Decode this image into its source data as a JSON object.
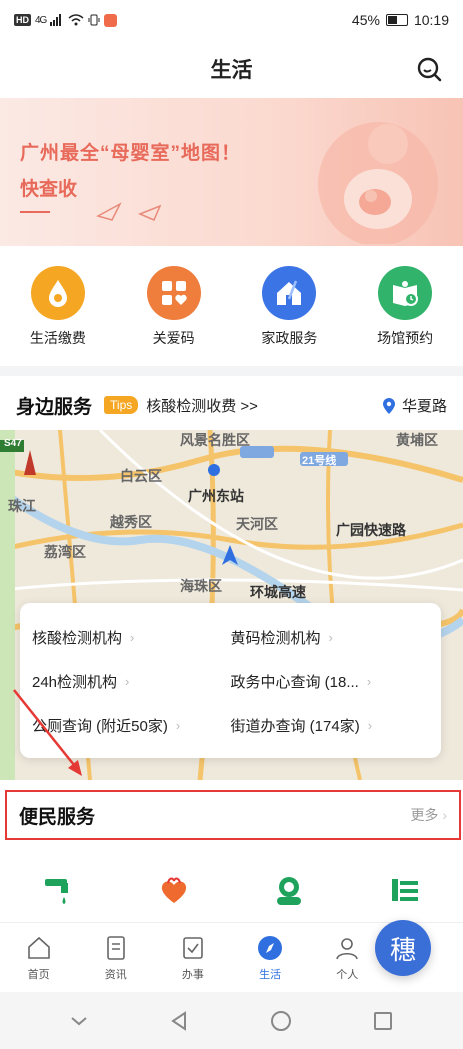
{
  "status_bar": {
    "battery": "45%",
    "time": "10:19",
    "net": "4G"
  },
  "header": {
    "title": "生活"
  },
  "banner": {
    "line1": "广州最全“母婴室”地图！",
    "line2": "快查收"
  },
  "quick_services": [
    {
      "label": "生活缴费",
      "icon": "water-drop-icon",
      "color": "#f5a623"
    },
    {
      "label": "关爱码",
      "icon": "care-code-icon",
      "color": "#ef7d3c"
    },
    {
      "label": "家政服务",
      "icon": "house-cleaning-icon",
      "color": "#3b74e5"
    },
    {
      "label": "场馆预约",
      "icon": "venue-booking-icon",
      "color": "#31b36b"
    }
  ],
  "nearby": {
    "title": "身边服务",
    "tips_badge": "Tips",
    "tips_text": "核酸检测收费 >>",
    "location": "华夏路"
  },
  "map_labels": [
    "风景名胜区",
    "黄埔区",
    "S47",
    "21号线",
    "白云区",
    "广州东站",
    "珠江",
    "越秀区",
    "天河区",
    "广园快速路",
    "荔湾区",
    "海珠区",
    "环城高速"
  ],
  "service_items": [
    {
      "label": "核酸检测机构"
    },
    {
      "label": "黄码检测机构"
    },
    {
      "label": "24h检测机构"
    },
    {
      "label": "政务中心查询 (18..."
    },
    {
      "label": "公厕查询 (附近50家)"
    },
    {
      "label": "街道办查询 (174家)"
    }
  ],
  "convenient": {
    "title": "便民服务",
    "more": "更多"
  },
  "tabs": [
    {
      "label": "首页",
      "icon": "home-icon",
      "active": false
    },
    {
      "label": "资讯",
      "icon": "news-icon",
      "active": false
    },
    {
      "label": "办事",
      "icon": "tasks-icon",
      "active": false
    },
    {
      "label": "生活",
      "icon": "life-compass-icon",
      "active": true
    },
    {
      "label": "个人",
      "icon": "profile-icon",
      "active": false
    }
  ],
  "fab": {
    "glyph": "穗"
  },
  "colors": {
    "accent": "#2f6fdf",
    "highlight_border": "#e53935",
    "tips": "#f5a623"
  }
}
